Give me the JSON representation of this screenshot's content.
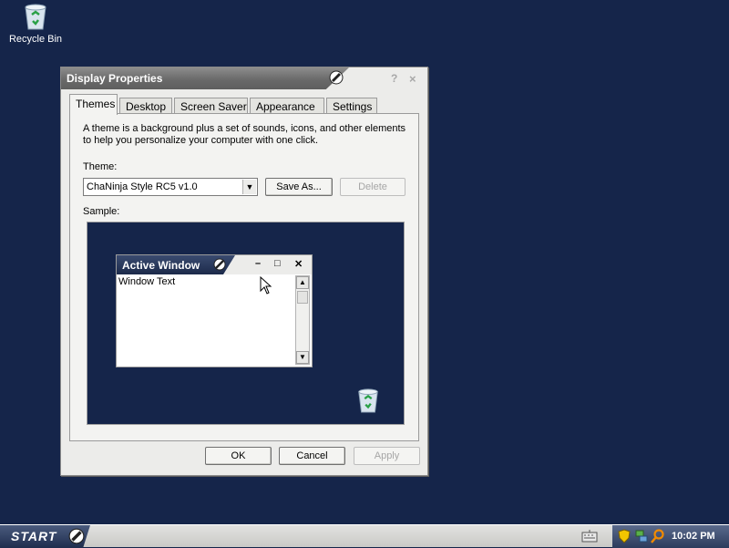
{
  "desktop": {
    "icons": [
      {
        "label": "Recycle Bin",
        "icon": "recycle-bin-icon"
      }
    ],
    "background_color": "#15254a"
  },
  "dialog": {
    "title": "Display Properties",
    "help_glyph": "?",
    "close_glyph": "×",
    "tabs": [
      {
        "label": "Themes",
        "active": true
      },
      {
        "label": "Desktop",
        "active": false
      },
      {
        "label": "Screen Saver",
        "active": false
      },
      {
        "label": "Appearance",
        "active": false
      },
      {
        "label": "Settings",
        "active": false
      }
    ],
    "description": "A theme is a background plus a set of sounds, icons, and other elements to help you personalize your computer with one click.",
    "theme_label": "Theme:",
    "theme_value": "ChaNinja Style RC5 v1.0",
    "save_as_label": "Save As...",
    "delete_label": "Delete",
    "sample_label": "Sample:",
    "sample": {
      "window_title": "Active Window",
      "minimize_glyph": "–",
      "maximize_glyph": "□",
      "close_glyph": "✕",
      "window_text": "Window Text"
    },
    "ok_label": "OK",
    "cancel_label": "Cancel",
    "apply_label": "Apply"
  },
  "taskbar": {
    "start_label": "START",
    "clock": "10:02 PM",
    "tray_icons": [
      "security-shield-icon",
      "network-icon",
      "search-icon"
    ]
  }
}
